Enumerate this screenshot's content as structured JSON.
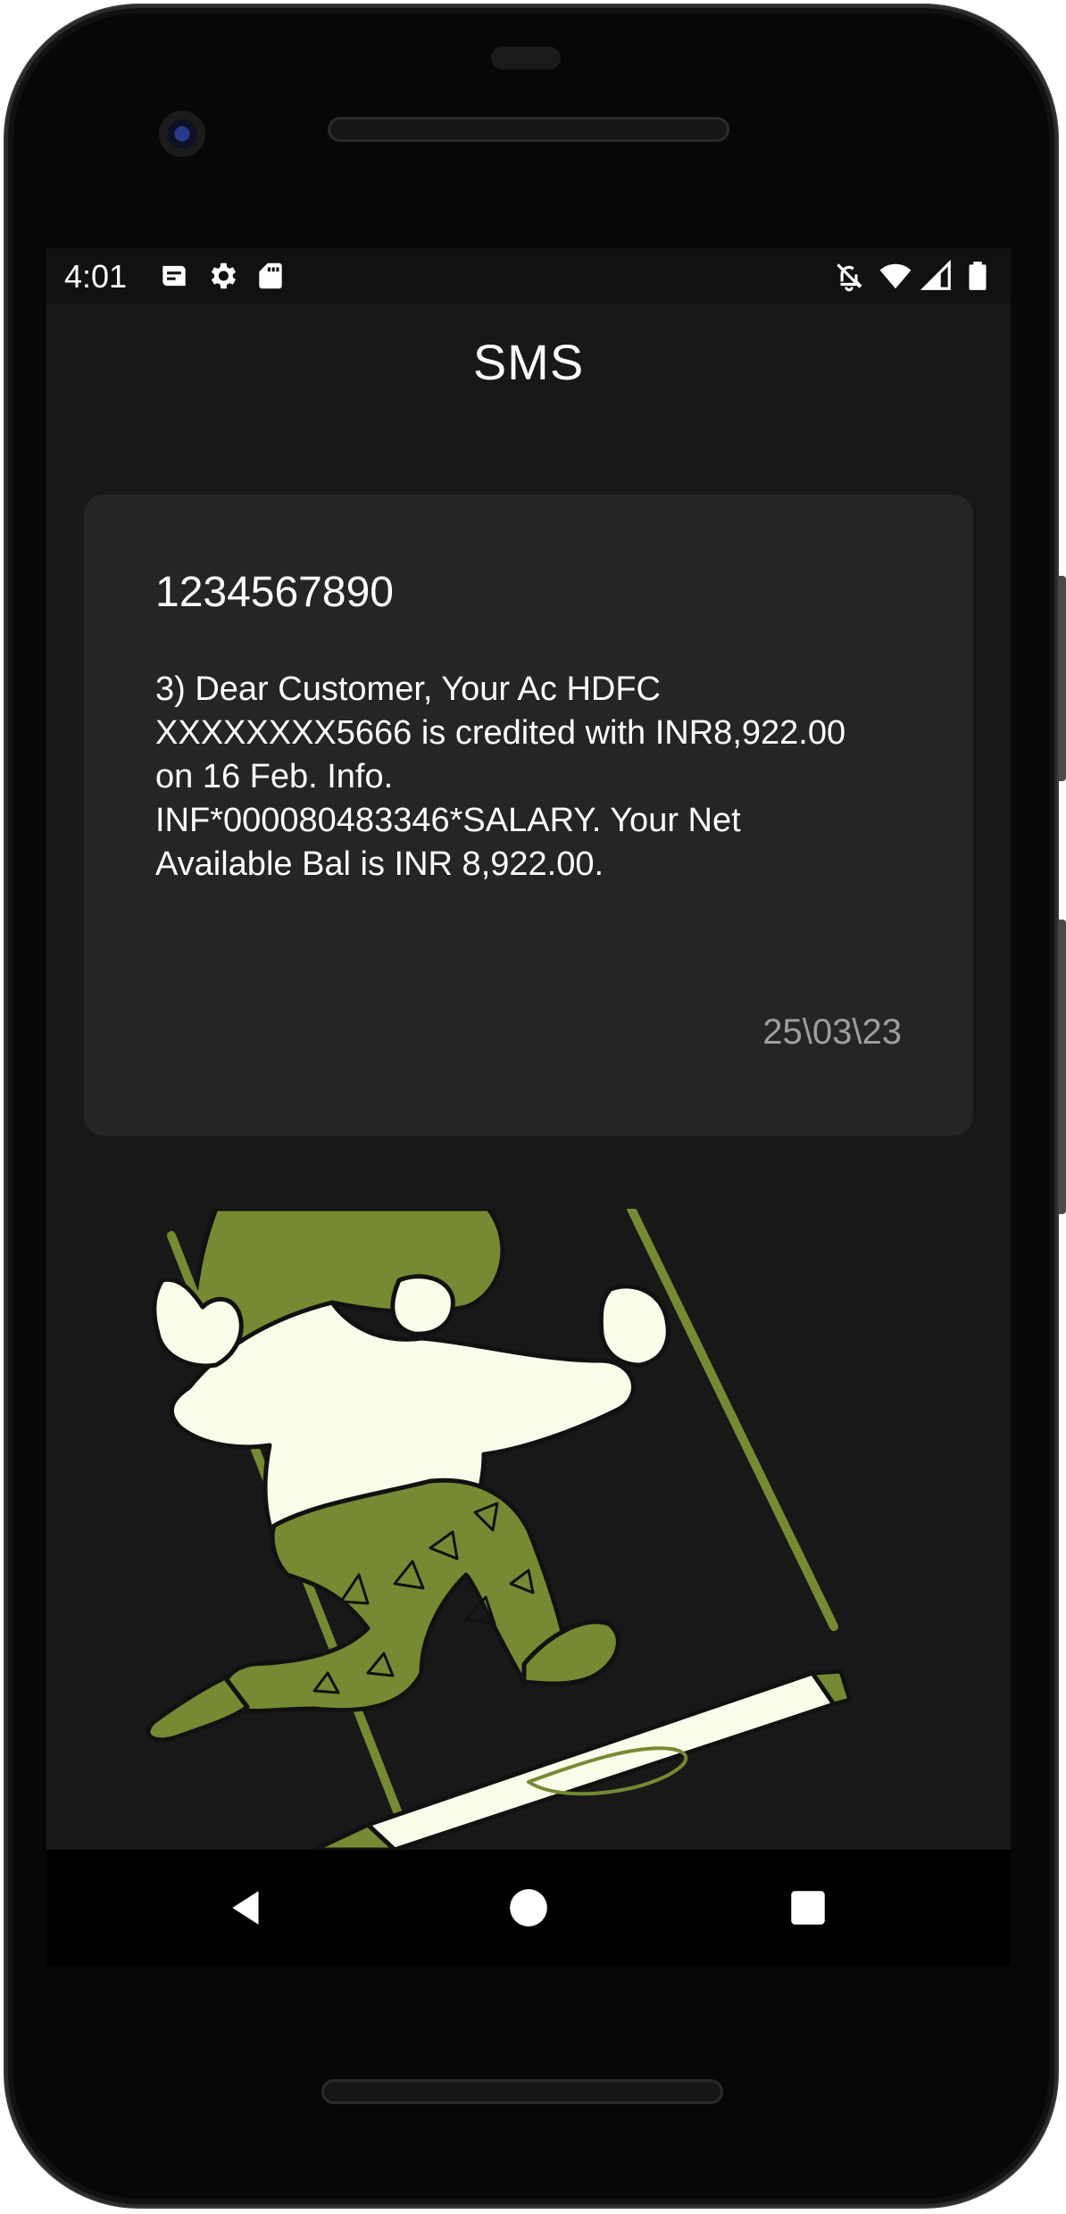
{
  "status_bar": {
    "time": "4:01",
    "left_icons": [
      "news-icon",
      "settings-icon",
      "sd-card-icon"
    ],
    "right_icons": [
      "notifications-off-icon",
      "wifi-icon",
      "cellular-signal-icon",
      "battery-icon"
    ]
  },
  "app_bar": {
    "title": "SMS"
  },
  "sms_card": {
    "sender": "1234567890",
    "message": "3) Dear Customer, Your Ac HDFC\nXXXXXXXX5666 is credited with INR8,922.00\non 16 Feb. Info.\nINF*000080483346*SALARY. Your Net\nAvailable Bal is INR 8,922.00.",
    "date": "25\\03\\23"
  },
  "illustration": {
    "name": "person-on-swing-illustration",
    "colors": {
      "green": "#758a32",
      "cream": "#fbfbea",
      "outline": "#111111"
    }
  },
  "nav_bar": {
    "buttons": [
      "back-icon",
      "home-icon",
      "recents-icon"
    ]
  },
  "colors": {
    "background": "#181818",
    "card": "#252525",
    "text": "#ffffff",
    "date_text": "#9e9e9e"
  }
}
